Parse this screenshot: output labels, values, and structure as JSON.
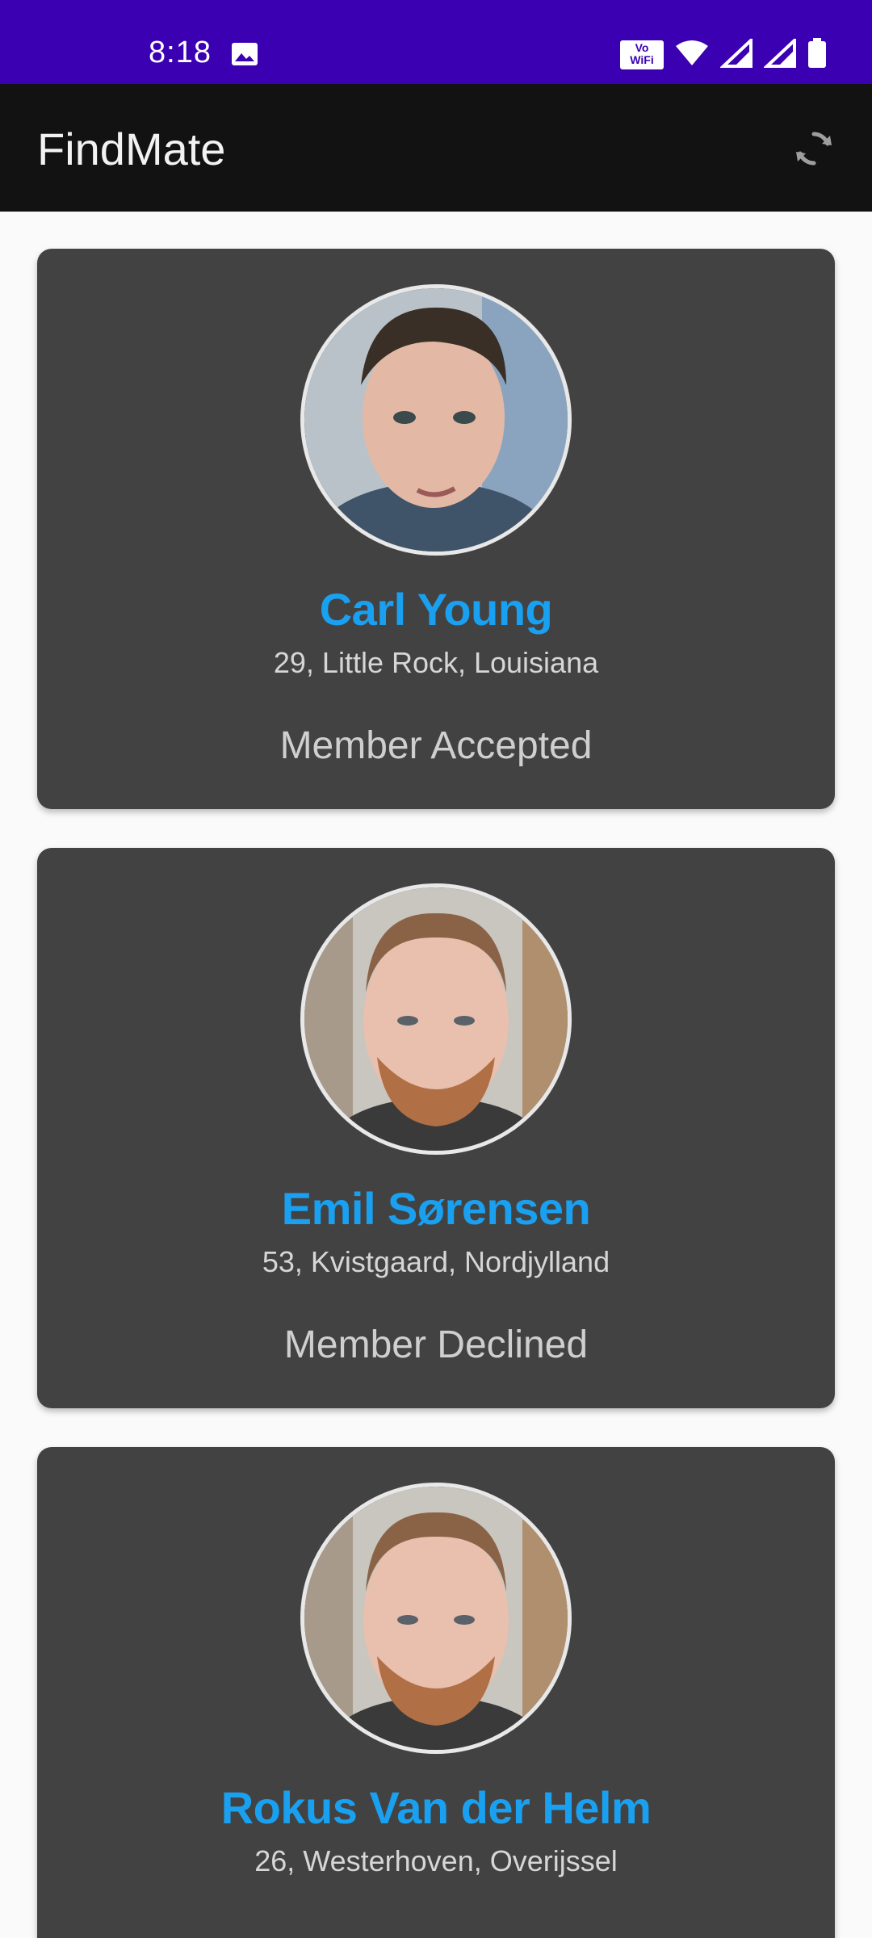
{
  "status_bar": {
    "time": "8:18",
    "icons": [
      "gallery-icon",
      "vowifi-icon",
      "wifi-icon",
      "signal-icon",
      "signal-roaming-icon",
      "battery-icon"
    ],
    "background_color": "#3a00b2",
    "vowifi_label_top": "Vo",
    "vowifi_label_bottom": "WiFi"
  },
  "app_bar": {
    "title": "FindMate",
    "refresh_icon": "refresh-icon",
    "background_color": "#121212"
  },
  "accent_color": "#1aa0f0",
  "members": [
    {
      "name": "Carl Young",
      "location": "29, Little Rock, Louisiana",
      "status": "Member Accepted",
      "avatar": "avatar-photo"
    },
    {
      "name": "Emil Sørensen",
      "location": "53, Kvistgaard, Nordjylland",
      "status": "Member Declined",
      "avatar": "avatar-photo"
    },
    {
      "name": "Rokus Van der Helm",
      "location": "26, Westerhoven, Overijssel",
      "status": "",
      "avatar": "avatar-photo"
    }
  ]
}
